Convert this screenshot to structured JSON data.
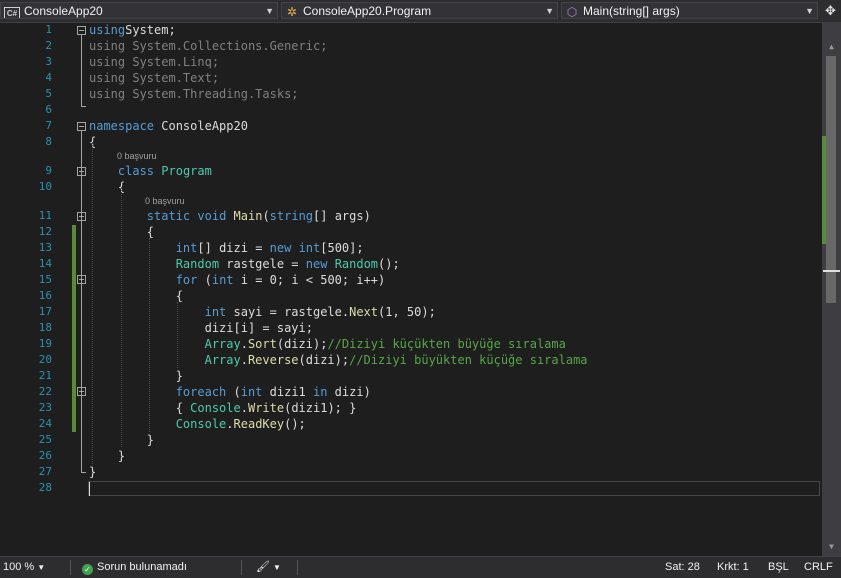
{
  "navbar": {
    "project": "ConsoleApp20",
    "type": "ConsoleApp20.Program",
    "member": "Main(string[] args)"
  },
  "hints": {
    "refs": "0 başvuru"
  },
  "lines": [
    {
      "n": "1",
      "t": [
        [
          "kw",
          "using"
        ],
        [
          "",
          "System;"
        ]
      ]
    },
    {
      "n": "2",
      "t": [
        [
          "gray",
          "using System.Collections.Generic;"
        ]
      ]
    },
    {
      "n": "3",
      "t": [
        [
          "gray",
          "using System.Linq;"
        ]
      ]
    },
    {
      "n": "4",
      "t": [
        [
          "gray",
          "using System.Text;"
        ]
      ]
    },
    {
      "n": "5",
      "t": [
        [
          "gray",
          "using System.Threading.Tasks;"
        ]
      ]
    },
    {
      "n": "6",
      "t": []
    },
    {
      "n": "7",
      "t": [
        [
          "kw",
          "namespace"
        ],
        [
          "",
          " ConsoleApp20"
        ]
      ]
    },
    {
      "n": "8",
      "t": [
        [
          "",
          "{"
        ]
      ]
    },
    {
      "n": "9",
      "t": [
        [
          "",
          "    "
        ],
        [
          "kw",
          "class"
        ],
        [
          "",
          " "
        ],
        [
          "ty",
          "Program"
        ]
      ]
    },
    {
      "n": "10",
      "t": [
        [
          "",
          "    {"
        ]
      ]
    },
    {
      "n": "11",
      "t": [
        [
          "",
          "        "
        ],
        [
          "kw",
          "static"
        ],
        [
          "",
          " "
        ],
        [
          "kw",
          "void"
        ],
        [
          "",
          " "
        ],
        [
          "fn",
          "Main"
        ],
        [
          "",
          "("
        ],
        [
          "kw",
          "string"
        ],
        [
          "",
          "[] args)"
        ]
      ]
    },
    {
      "n": "12",
      "t": [
        [
          "",
          "        {"
        ]
      ]
    },
    {
      "n": "13",
      "t": [
        [
          "",
          "            "
        ],
        [
          "kw",
          "int"
        ],
        [
          "",
          "[] dizi = "
        ],
        [
          "kw",
          "new"
        ],
        [
          "",
          " "
        ],
        [
          "kw",
          "int"
        ],
        [
          "",
          "[500];"
        ]
      ]
    },
    {
      "n": "14",
      "t": [
        [
          "",
          "            "
        ],
        [
          "ty",
          "Random"
        ],
        [
          "",
          " rastgele = "
        ],
        [
          "kw",
          "new"
        ],
        [
          "",
          " "
        ],
        [
          "ty",
          "Random"
        ],
        [
          "",
          "();"
        ]
      ]
    },
    {
      "n": "15",
      "t": [
        [
          "",
          "            "
        ],
        [
          "kw",
          "for"
        ],
        [
          "",
          " ("
        ],
        [
          "kw",
          "int"
        ],
        [
          "",
          " i = 0; i < 500; i++)"
        ]
      ]
    },
    {
      "n": "16",
      "t": [
        [
          "",
          "            {"
        ]
      ]
    },
    {
      "n": "17",
      "t": [
        [
          "",
          "                "
        ],
        [
          "kw",
          "int"
        ],
        [
          "",
          " sayi = rastgele."
        ],
        [
          "fn",
          "Next"
        ],
        [
          "",
          "(1, 50);"
        ]
      ]
    },
    {
      "n": "18",
      "t": [
        [
          "",
          "                dizi[i] = sayi;"
        ]
      ]
    },
    {
      "n": "19",
      "t": [
        [
          "",
          "                "
        ],
        [
          "ty",
          "Array"
        ],
        [
          "",
          "."
        ],
        [
          "fn",
          "Sort"
        ],
        [
          "",
          "(dizi);"
        ],
        [
          "cm",
          "//Diziyi küçükten büyüğe sıralama"
        ]
      ]
    },
    {
      "n": "20",
      "t": [
        [
          "",
          "                "
        ],
        [
          "ty",
          "Array"
        ],
        [
          "",
          "."
        ],
        [
          "fn",
          "Reverse"
        ],
        [
          "",
          "(dizi);"
        ],
        [
          "cm",
          "//Diziyi büyükten küçüğe sıralama"
        ]
      ]
    },
    {
      "n": "21",
      "t": [
        [
          "",
          "            }"
        ]
      ]
    },
    {
      "n": "22",
      "t": [
        [
          "",
          "            "
        ],
        [
          "kw",
          "foreach"
        ],
        [
          "",
          " ("
        ],
        [
          "kw",
          "int"
        ],
        [
          "",
          " dizi1 "
        ],
        [
          "kw",
          "in"
        ],
        [
          "",
          " dizi)"
        ]
      ]
    },
    {
      "n": "23",
      "t": [
        [
          "",
          "            { "
        ],
        [
          "ty",
          "Console"
        ],
        [
          "",
          "."
        ],
        [
          "fn",
          "Write"
        ],
        [
          "",
          "(dizi1); }"
        ]
      ]
    },
    {
      "n": "24",
      "t": [
        [
          "",
          "            "
        ],
        [
          "ty",
          "Console"
        ],
        [
          "",
          "."
        ],
        [
          "fn",
          "ReadKey"
        ],
        [
          "",
          "();"
        ]
      ]
    },
    {
      "n": "25",
      "t": [
        [
          "",
          "        }"
        ]
      ]
    },
    {
      "n": "26",
      "t": [
        [
          "",
          "    }"
        ]
      ]
    },
    {
      "n": "27",
      "t": [
        [
          "",
          "}"
        ]
      ]
    },
    {
      "n": "28",
      "t": []
    }
  ],
  "status": {
    "zoom": "100 %",
    "issues": "Sorun bulunamadı",
    "line": "Sat: 28",
    "col": "Krkt: 1",
    "mode": "BŞL",
    "eol": "CRLF"
  }
}
